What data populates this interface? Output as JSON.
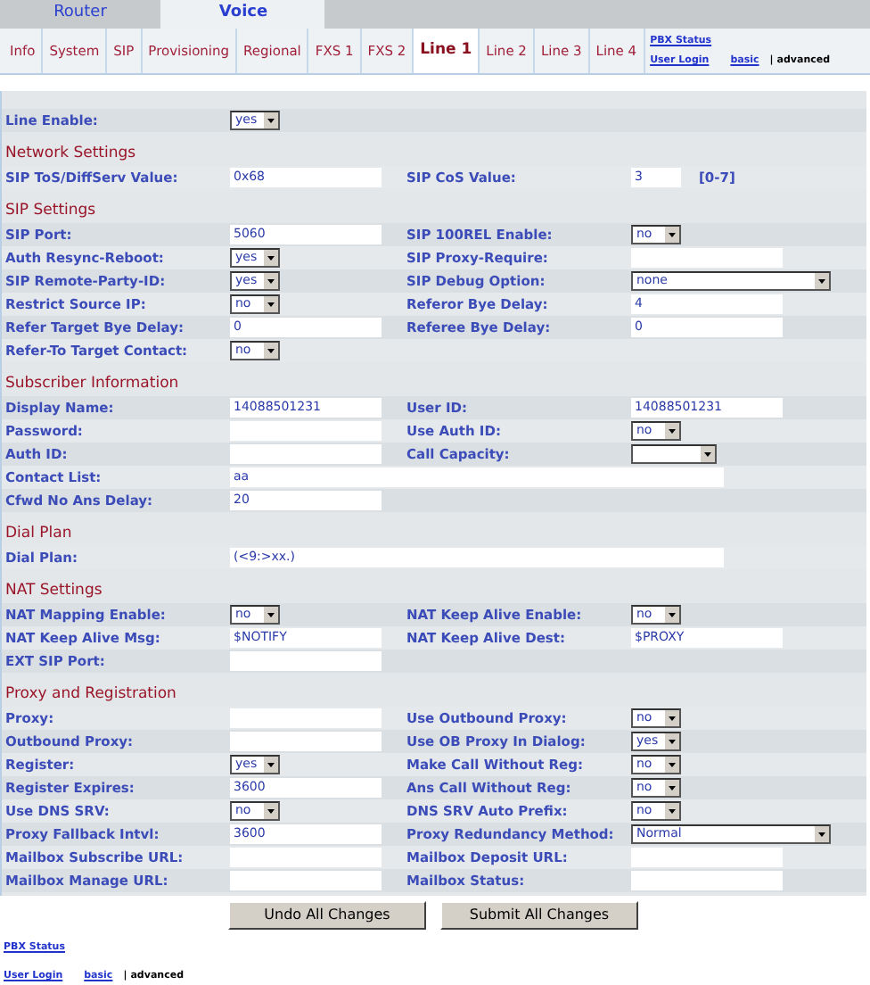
{
  "main_tabs": [
    {
      "label": "Router",
      "selected": false
    },
    {
      "label": "Voice",
      "selected": true
    }
  ],
  "sub_tabs": [
    {
      "label": "Info",
      "selected": false
    },
    {
      "label": "System",
      "selected": false
    },
    {
      "label": "SIP",
      "selected": false
    },
    {
      "label": "Provisioning",
      "selected": false
    },
    {
      "label": "Regional",
      "selected": false
    },
    {
      "label": "FXS 1",
      "selected": false
    },
    {
      "label": "FXS 2",
      "selected": false
    },
    {
      "label": "Line 1",
      "selected": true
    },
    {
      "label": "Line 2",
      "selected": false
    },
    {
      "label": "Line 3",
      "selected": false
    },
    {
      "label": "Line 4",
      "selected": false
    }
  ],
  "header_links": {
    "pbx_status": "PBX Status",
    "user_login": "User Login",
    "modes": [
      {
        "label": "basic",
        "selected": false
      },
      {
        "label": "advanced",
        "selected": true
      }
    ],
    "separator": "|"
  },
  "sections": [
    {
      "rows": [
        {
          "left": {
            "label": "Line Enable:",
            "control": {
              "kind": "select",
              "value": "yes"
            }
          }
        }
      ]
    },
    {
      "title": "Network Settings",
      "rows": [
        {
          "left": {
            "label": "SIP ToS/DiffServ Value:",
            "control": {
              "kind": "input",
              "value": "0x68"
            }
          },
          "right": {
            "label": "SIP CoS Value:",
            "control": {
              "kind": "input",
              "value": "3",
              "short": true
            },
            "hint": "[0-7]"
          }
        }
      ]
    },
    {
      "title": "SIP Settings",
      "rows": [
        {
          "left": {
            "label": "SIP Port:",
            "control": {
              "kind": "input",
              "value": "5060"
            }
          },
          "right": {
            "label": "SIP 100REL Enable:",
            "control": {
              "kind": "select",
              "value": "no"
            }
          }
        },
        {
          "left": {
            "label": "Auth Resync-Reboot:",
            "control": {
              "kind": "select",
              "value": "yes"
            }
          },
          "right": {
            "label": "SIP Proxy-Require:",
            "control": {
              "kind": "input"
            }
          }
        },
        {
          "left": {
            "label": "SIP Remote-Party-ID:",
            "control": {
              "kind": "select",
              "value": "yes"
            }
          },
          "right": {
            "label": "SIP Debug Option:",
            "control": {
              "kind": "select",
              "value": "none",
              "wide": true
            }
          }
        },
        {
          "left": {
            "label": "Restrict Source IP:",
            "control": {
              "kind": "select",
              "value": "no"
            }
          },
          "right": {
            "label": "Referor Bye Delay:",
            "control": {
              "kind": "input",
              "value": "4"
            }
          }
        },
        {
          "left": {
            "label": "Refer Target Bye Delay:",
            "control": {
              "kind": "input",
              "value": "0"
            }
          },
          "right": {
            "label": "Referee Bye Delay:",
            "control": {
              "kind": "input",
              "value": "0"
            }
          }
        },
        {
          "left": {
            "label": "Refer-To Target Contact:",
            "control": {
              "kind": "select",
              "value": "no"
            }
          }
        }
      ]
    },
    {
      "title": "Subscriber Information",
      "rows": [
        {
          "left": {
            "label": "Display Name:",
            "control": {
              "kind": "input",
              "value": "14088501231"
            }
          },
          "right": {
            "label": "User ID:",
            "control": {
              "kind": "input",
              "value": "14088501231"
            }
          }
        },
        {
          "left": {
            "label": "Password:",
            "control": {
              "kind": "input"
            }
          },
          "right": {
            "label": "Use Auth ID:",
            "control": {
              "kind": "select",
              "value": "no"
            }
          }
        },
        {
          "left": {
            "label": "Auth ID:",
            "control": {
              "kind": "input"
            }
          },
          "right": {
            "label": "Call Capacity:",
            "control": {
              "kind": "select"
            }
          }
        },
        {
          "left": {
            "label": "Contact List:",
            "control": {
              "kind": "input",
              "value": "aa",
              "wide": true
            }
          }
        },
        {
          "left": {
            "label": "Cfwd No Ans Delay:",
            "control": {
              "kind": "input",
              "value": "20"
            }
          }
        }
      ]
    },
    {
      "title": "Dial Plan",
      "rows": [
        {
          "left": {
            "label": "Dial Plan:",
            "control": {
              "kind": "input",
              "value": "(<9:>xx.)",
              "wide": true
            }
          }
        }
      ]
    },
    {
      "title": "NAT Settings",
      "rows": [
        {
          "left": {
            "label": "NAT Mapping Enable:",
            "control": {
              "kind": "select",
              "value": "no"
            }
          },
          "right": {
            "label": "NAT Keep Alive Enable:",
            "control": {
              "kind": "select",
              "value": "no"
            }
          }
        },
        {
          "left": {
            "label": "NAT Keep Alive Msg:",
            "control": {
              "kind": "input",
              "value": "$NOTIFY"
            }
          },
          "right": {
            "label": "NAT Keep Alive Dest:",
            "control": {
              "kind": "input",
              "value": "$PROXY"
            }
          }
        },
        {
          "left": {
            "label": "EXT SIP Port:",
            "control": {
              "kind": "input"
            }
          }
        }
      ]
    },
    {
      "title": "Proxy and Registration",
      "rows": [
        {
          "left": {
            "label": "Proxy:",
            "control": {
              "kind": "input"
            }
          },
          "right": {
            "label": "Use Outbound Proxy:",
            "control": {
              "kind": "select",
              "value": "no"
            }
          }
        },
        {
          "left": {
            "label": "Outbound Proxy:",
            "control": {
              "kind": "input"
            }
          },
          "right": {
            "label": "Use OB Proxy In Dialog:",
            "control": {
              "kind": "select",
              "value": "yes"
            }
          }
        },
        {
          "left": {
            "label": "Register:",
            "control": {
              "kind": "select",
              "value": "yes"
            }
          },
          "right": {
            "label": "Make Call Without Reg:",
            "control": {
              "kind": "select",
              "value": "no"
            }
          }
        },
        {
          "left": {
            "label": "Register Expires:",
            "control": {
              "kind": "input",
              "value": "3600"
            }
          },
          "right": {
            "label": "Ans Call Without Reg:",
            "control": {
              "kind": "select",
              "value": "no"
            }
          }
        },
        {
          "left": {
            "label": "Use DNS SRV:",
            "control": {
              "kind": "select",
              "value": "no"
            }
          },
          "right": {
            "label": "DNS SRV Auto Prefix:",
            "control": {
              "kind": "select",
              "value": "no"
            }
          }
        },
        {
          "left": {
            "label": "Proxy Fallback Intvl:",
            "control": {
              "kind": "input",
              "value": "3600"
            }
          },
          "right": {
            "label": "Proxy Redundancy Method:",
            "control": {
              "kind": "select",
              "value": "Normal",
              "wide": true
            }
          }
        },
        {
          "left": {
            "label": "Mailbox Subscribe URL:",
            "control": {
              "kind": "input"
            }
          },
          "right": {
            "label": "Mailbox Deposit URL:",
            "control": {
              "kind": "input"
            }
          }
        },
        {
          "left": {
            "label": "Mailbox Manage URL:",
            "control": {
              "kind": "input"
            }
          },
          "right": {
            "label": "Mailbox Status:",
            "control": {
              "kind": "input"
            }
          }
        }
      ]
    }
  ],
  "buttons": [
    "Undo All Changes",
    "Submit All Changes"
  ],
  "footer_links": {
    "pbx_status": "PBX Status",
    "user_login": "User Login",
    "modes": [
      {
        "label": "basic",
        "selected": false
      },
      {
        "label": "advanced",
        "selected": true
      }
    ],
    "separator": "|"
  }
}
